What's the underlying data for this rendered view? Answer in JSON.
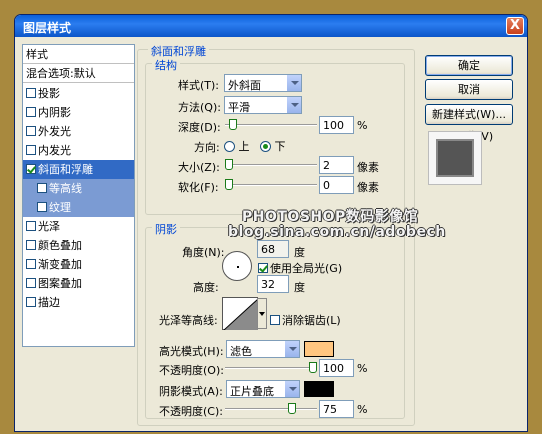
{
  "window": {
    "title": "图层样式",
    "close_label": "X"
  },
  "style_list": {
    "header": "样式",
    "blend": "混合选项:默认",
    "items": [
      {
        "label": "投影",
        "checked": false
      },
      {
        "label": "内阴影",
        "checked": false
      },
      {
        "label": "外发光",
        "checked": false
      },
      {
        "label": "内发光",
        "checked": false
      },
      {
        "label": "斜面和浮雕",
        "checked": true
      },
      {
        "label": "等高线",
        "checked": false
      },
      {
        "label": "纹理",
        "checked": false
      },
      {
        "label": "光泽",
        "checked": false
      },
      {
        "label": "颜色叠加",
        "checked": false
      },
      {
        "label": "渐变叠加",
        "checked": false
      },
      {
        "label": "图案叠加",
        "checked": false
      },
      {
        "label": "描边",
        "checked": false
      }
    ]
  },
  "bevel": {
    "group_title": "斜面和浮雕",
    "structure_title": "结构",
    "style_label": "样式(T):",
    "style_value": "外斜面",
    "method_label": "方法(Q):",
    "method_value": "平滑",
    "depth_label": "深度(D):",
    "depth_value": "100",
    "depth_unit": "%",
    "direction_label": "方向:",
    "dir_up": "上",
    "dir_down": "下",
    "size_label": "大小(Z):",
    "size_value": "2",
    "size_unit": "像素",
    "soften_label": "软化(F):",
    "soften_value": "0",
    "soften_unit": "像素"
  },
  "shading": {
    "group_title": "阴影",
    "angle_label": "角度(N):",
    "angle_value": "68",
    "angle_unit": "度",
    "global_light_label": "使用全局光(G)",
    "altitude_label": "高度:",
    "altitude_value": "32",
    "altitude_unit": "度",
    "gloss_label": "光泽等高线:",
    "antialias_label": "消除锯齿(L)",
    "highlight_mode_label": "高光模式(H):",
    "highlight_mode_value": "滤色",
    "highlight_color": "#ffc680",
    "highlight_opacity_label": "不透明度(O):",
    "highlight_opacity_value": "100",
    "shadow_mode_label": "阴影模式(A):",
    "shadow_mode_value": "正片叠底",
    "shadow_color": "#000000",
    "shadow_opacity_label": "不透明度(C):",
    "shadow_opacity_value": "75",
    "percent": "%"
  },
  "buttons": {
    "ok": "确定",
    "cancel": "取消",
    "new_style": "新建样式(W)...",
    "preview": "预览(V)"
  },
  "watermark": {
    "line1": "PHOTOSHOP数码影像馆",
    "line2": "blog.sina.com.cn/adobech"
  }
}
